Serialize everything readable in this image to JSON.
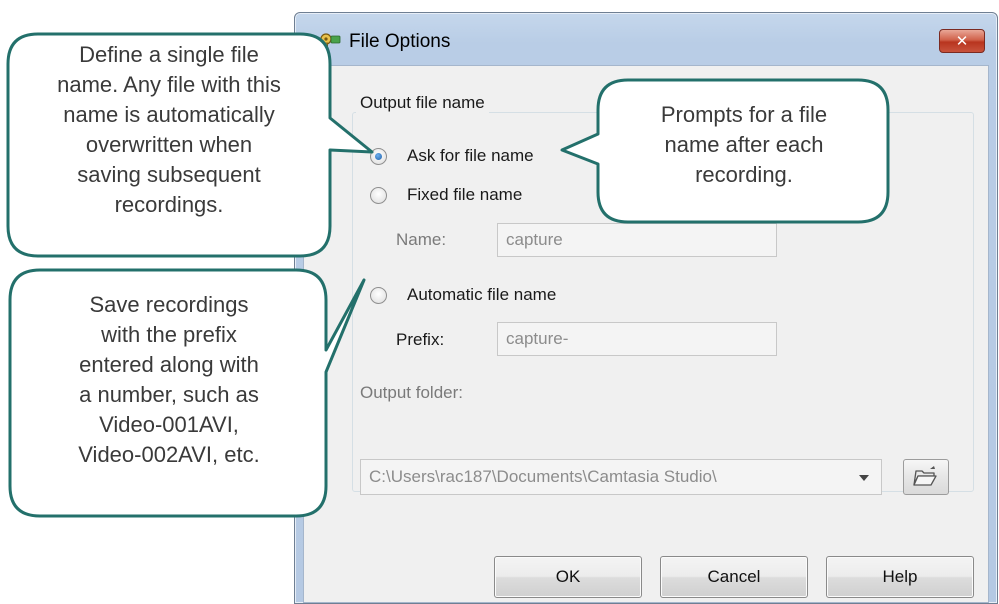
{
  "window": {
    "title": "File Options",
    "close_glyph": "✕",
    "app_icon": "key-icon"
  },
  "group": {
    "title": "Output file name"
  },
  "options": {
    "ask_label": "Ask for file name",
    "fixed_label": "Fixed file name",
    "automatic_label": "Automatic file name",
    "selected": "ask"
  },
  "fields": {
    "name_label": "Name:",
    "name_value": "capture",
    "prefix_label": "Prefix:",
    "prefix_value": "capture-",
    "output_folder_label": "Output folder:",
    "output_folder_value": "C:\\Users\\rac187\\Documents\\Camtasia Studio\\",
    "browse_icon": "open-folder-icon"
  },
  "buttons": {
    "ok": "OK",
    "cancel": "Cancel",
    "help": "Help"
  },
  "callouts": {
    "fixed_line1": "Define a single file",
    "fixed_line2": "name. Any file with this",
    "fixed_line3": "name is automatically",
    "fixed_line4": "overwritten when",
    "fixed_line5": "saving subsequent",
    "fixed_line6": "recordings.",
    "auto_line1": "Save recordings",
    "auto_line2": "with the prefix",
    "auto_line3": "entered along with",
    "auto_line4": "a number, such as",
    "auto_line5": "Video-001AVI,",
    "auto_line6": "Video-002AVI, etc.",
    "ask_line1": "Prompts for a file",
    "ask_line2": "name after each",
    "ask_line3": "recording."
  },
  "colors": {
    "callout_border": "#23706b",
    "callout_fill": "#ffffff",
    "titlebar": "#c1d4ea",
    "close_button": "#c8503a"
  }
}
